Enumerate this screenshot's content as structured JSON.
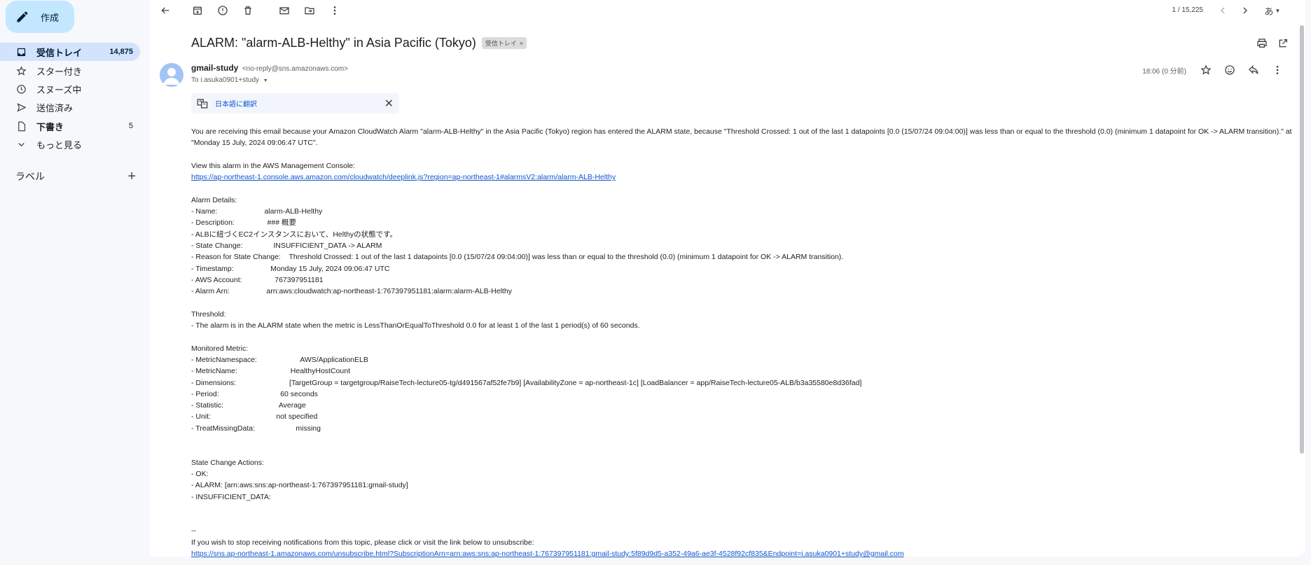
{
  "sidebar": {
    "compose_label": "作成",
    "items": [
      {
        "label": "受信トレイ",
        "count": "14,875",
        "icon": "inbox-icon"
      },
      {
        "label": "スター付き",
        "count": "",
        "icon": "star-icon"
      },
      {
        "label": "スヌーズ中",
        "count": "",
        "icon": "clock-icon"
      },
      {
        "label": "送信済み",
        "count": "",
        "icon": "send-icon"
      },
      {
        "label": "下書き",
        "count": "5",
        "icon": "draft-icon"
      },
      {
        "label": "もっと見る",
        "count": "",
        "icon": "chevron-down-icon"
      }
    ],
    "labels_title": "ラベル",
    "labels_add": "+"
  },
  "toolbar": {
    "pager": "1 / 15,225",
    "input_tool": "あ"
  },
  "email": {
    "subject": "ALARM: \"alarm-ALB-Helthy\" in Asia Pacific (Tokyo)",
    "label": "受信トレイ",
    "label_close": "×",
    "sender_name": "gmail-study",
    "sender_email": "<no-reply@sns.amazonaws.com>",
    "to": "To i.asuka0901+study",
    "date": "18:06 (0 分前)",
    "translate_label": "日本語に翻訳",
    "body": {
      "intro": "You are receiving this email because your Amazon CloudWatch Alarm \"alarm-ALB-Helthy\" in the Asia Pacific (Tokyo) region has entered the ALARM state, because \"Threshold Crossed: 1 out of the last 1 datapoints [0.0 (15/07/24 09:04:00)] was less than or equal to the threshold (0.0) (minimum 1 datapoint for OK -> ALARM transition).\" at \"Monday 15 July, 2024 09:06:47 UTC\".",
      "console_title": "View this alarm in the AWS Management Console:",
      "console_link": "https://ap-northeast-1.console.aws.amazon.com/cloudwatch/deeplink.js?region=ap-northeast-1#alarmsV2:alarm/alarm-ALB-Helthy",
      "details_title": "Alarm Details:",
      "details": [
        {
          "k": "- Name:                       ",
          "v": "alarm-ALB-Helthy"
        },
        {
          "k": "- Description:                ",
          "v": "### 概要"
        },
        {
          "k": "- ALBに紐づくEC2インスタンスにおいて、Helthyの状態です。",
          "v": ""
        },
        {
          "k": "- State Change:               ",
          "v": "INSUFFICIENT_DATA -> ALARM"
        },
        {
          "k": "- Reason for State Change:    ",
          "v": "Threshold Crossed: 1 out of the last 1 datapoints [0.0 (15/07/24 09:04:00)] was less than or equal to the threshold (0.0) (minimum 1 datapoint for OK -> ALARM transition)."
        },
        {
          "k": "- Timestamp:                  ",
          "v": "Monday 15 July, 2024 09:06:47 UTC"
        },
        {
          "k": "- AWS Account:                ",
          "v": "767397951181"
        },
        {
          "k": "- Alarm Arn:                  ",
          "v": "arn:aws:cloudwatch:ap-northeast-1:767397951181:alarm:alarm-ALB-Helthy"
        }
      ],
      "threshold_title": "Threshold:",
      "threshold_text": "- The alarm is in the ALARM state when the metric is LessThanOrEqualToThreshold 0.0 for at least 1 of the last 1 period(s) of 60 seconds.",
      "metric_title": "Monitored Metric:",
      "metric": [
        {
          "k": "- MetricNamespace:                     ",
          "v": "AWS/ApplicationELB"
        },
        {
          "k": "- MetricName:                          ",
          "v": "HealthyHostCount"
        },
        {
          "k": "- Dimensions:                          ",
          "v": "[TargetGroup = targetgroup/RaiseTech-lecture05-tg/d491567af52fe7b9] [AvailabilityZone = ap-northeast-1c] [LoadBalancer = app/RaiseTech-lecture05-ALB/b3a35580e8d36fad]"
        },
        {
          "k": "- Period:                              ",
          "v": "60 seconds"
        },
        {
          "k": "- Statistic:                           ",
          "v": "Average"
        },
        {
          "k": "- Unit:                                ",
          "v": "not specified"
        },
        {
          "k": "- TreatMissingData:                    ",
          "v": "missing"
        }
      ],
      "actions_title": "State Change Actions:",
      "actions": [
        "- OK:",
        "- ALARM: [arn:aws:sns:ap-northeast-1:767397951181:gmail-study]",
        "- INSUFFICIENT_DATA:"
      ],
      "signature_dash": "--",
      "unsubscribe_text": "If you wish to stop receiving notifications from this topic, please click or visit the link below to unsubscribe:",
      "unsubscribe_link": "https://sns.ap-northeast-1.amazonaws.com/unsubscribe.html?SubscriptionArn=arn:aws:sns:ap-northeast-1:767397951181:gmail-study:5f89d9d5-a352-49a6-ae3f-4528f92cf835&Endpoint=i.asuka0901+study@gmail.com"
    }
  }
}
